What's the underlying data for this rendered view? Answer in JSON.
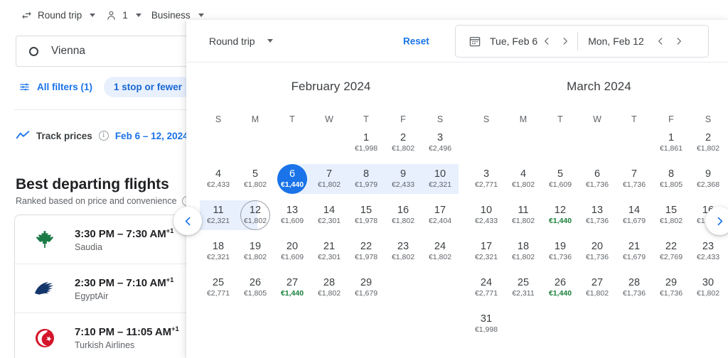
{
  "top_controls": [
    {
      "icon": "swap-icon",
      "label": "Round trip"
    },
    {
      "icon": "person-icon",
      "label": "1"
    },
    {
      "icon": "",
      "label": "Business"
    }
  ],
  "search": {
    "origin_value": "Vienna",
    "origin_icon": "origin-circle-icon"
  },
  "filters": {
    "all_filters_label": "All filters (1)",
    "filter_icon": "tune-icon",
    "chips": [
      "1 stop or fewer"
    ]
  },
  "track_prices": {
    "icon": "trend-line-icon",
    "label": "Track prices",
    "info_icon": "info-icon",
    "date_range": "Feb 6 – 12, 2024"
  },
  "results": {
    "title": "Best departing flights",
    "subtitle": "Ranked based on price and convenience",
    "subtitle_info_icon": "info-icon",
    "flights": [
      {
        "times": "3:30 PM – 7:30 AM",
        "plus_days": "+1",
        "airline": "Saudia",
        "logo": "saudia-logo",
        "logo_color": "#1a7a46"
      },
      {
        "times": "2:30 PM – 7:10 AM",
        "plus_days": "+1",
        "airline": "EgyptAir",
        "logo": "egyptair-logo",
        "logo_color": "#14366b"
      },
      {
        "times": "7:10 PM – 11:05 AM",
        "plus_days": "+1",
        "airline": "Turkish Airlines",
        "logo": "turkish-logo",
        "logo_color": "#d4142a"
      }
    ]
  },
  "calendar_panel": {
    "trip_type": "Round trip",
    "trip_type_caret": "chevron-down-icon",
    "reset_label": "Reset",
    "date_picker": {
      "calendar_icon": "calendar-icon",
      "depart_value": "Tue, Feb 6",
      "depart_prev_icon": "chevron-left-icon",
      "depart_next_icon": "chevron-right-icon",
      "return_value": "Mon, Feb 12",
      "return_prev_icon": "chevron-left-icon",
      "return_next_icon": "chevron-right-icon"
    },
    "prev_month_icon": "chevron-left-icon",
    "next_month_icon": "chevron-right-icon",
    "weekday_labels": [
      "S",
      "M",
      "T",
      "W",
      "T",
      "F",
      "S"
    ],
    "colors": {
      "selected": "#1a73e8",
      "range": "#e8f0fe",
      "cheap_price": "#188038",
      "link": "#1a73e8"
    },
    "months": [
      {
        "title": "February 2024",
        "lead_blank": 4,
        "days": [
          {
            "n": "1",
            "price": "€1,998"
          },
          {
            "n": "2",
            "price": "€1,802"
          },
          {
            "n": "3",
            "price": "€2,496"
          },
          {
            "n": "4",
            "price": "€2,433"
          },
          {
            "n": "5",
            "price": "€1,802"
          },
          {
            "n": "6",
            "price": "€1,440",
            "state": "selected"
          },
          {
            "n": "7",
            "price": "€1,802",
            "state": "range"
          },
          {
            "n": "8",
            "price": "€1,979",
            "state": "range"
          },
          {
            "n": "9",
            "price": "€2,433",
            "state": "range"
          },
          {
            "n": "10",
            "price": "€2,321",
            "state": "range"
          },
          {
            "n": "11",
            "price": "€2,321",
            "state": "range"
          },
          {
            "n": "12",
            "price": "€1,802",
            "state": "return"
          },
          {
            "n": "13",
            "price": "€1,609"
          },
          {
            "n": "14",
            "price": "€2,301"
          },
          {
            "n": "15",
            "price": "€1,978"
          },
          {
            "n": "16",
            "price": "€1,802"
          },
          {
            "n": "17",
            "price": "€2,404"
          },
          {
            "n": "18",
            "price": "€2,321"
          },
          {
            "n": "19",
            "price": "€1,802"
          },
          {
            "n": "20",
            "price": "€1,609"
          },
          {
            "n": "21",
            "price": "€2,301"
          },
          {
            "n": "22",
            "price": "€1,978"
          },
          {
            "n": "23",
            "price": "€1,802"
          },
          {
            "n": "24",
            "price": "€1,802"
          },
          {
            "n": "25",
            "price": "€2,771"
          },
          {
            "n": "26",
            "price": "€1,805"
          },
          {
            "n": "27",
            "price": "€1,440",
            "cheap": true
          },
          {
            "n": "28",
            "price": "€1,802"
          },
          {
            "n": "29",
            "price": "€1,679"
          }
        ]
      },
      {
        "title": "March 2024",
        "lead_blank": 5,
        "days": [
          {
            "n": "1",
            "price": "€1,861"
          },
          {
            "n": "2",
            "price": "€1,802"
          },
          {
            "n": "3",
            "price": "€2,771"
          },
          {
            "n": "4",
            "price": "€1,802"
          },
          {
            "n": "5",
            "price": "€1,609"
          },
          {
            "n": "6",
            "price": "€1,736"
          },
          {
            "n": "7",
            "price": "€1,736"
          },
          {
            "n": "8",
            "price": "€1,805"
          },
          {
            "n": "9",
            "price": "€2,368"
          },
          {
            "n": "10",
            "price": "€2,433"
          },
          {
            "n": "11",
            "price": "€1,802"
          },
          {
            "n": "12",
            "price": "€1,440",
            "cheap": true
          },
          {
            "n": "13",
            "price": "€1,736"
          },
          {
            "n": "14",
            "price": "€1,679"
          },
          {
            "n": "15",
            "price": "€1,802"
          },
          {
            "n": "16",
            "price": "€1,736"
          },
          {
            "n": "17",
            "price": "€2,321"
          },
          {
            "n": "18",
            "price": "€1,802"
          },
          {
            "n": "19",
            "price": "€1,736"
          },
          {
            "n": "20",
            "price": "€1,736"
          },
          {
            "n": "21",
            "price": "€1,679"
          },
          {
            "n": "22",
            "price": "€2,769"
          },
          {
            "n": "23",
            "price": "€2,433"
          },
          {
            "n": "24",
            "price": "€2,771"
          },
          {
            "n": "25",
            "price": "€2,311"
          },
          {
            "n": "26",
            "price": "€1,440",
            "cheap": true
          },
          {
            "n": "27",
            "price": "€1,802"
          },
          {
            "n": "28",
            "price": "€1,736"
          },
          {
            "n": "29",
            "price": "€1,736"
          },
          {
            "n": "30",
            "price": "€1,802"
          },
          {
            "n": "31",
            "price": "€1,998"
          }
        ]
      }
    ]
  }
}
